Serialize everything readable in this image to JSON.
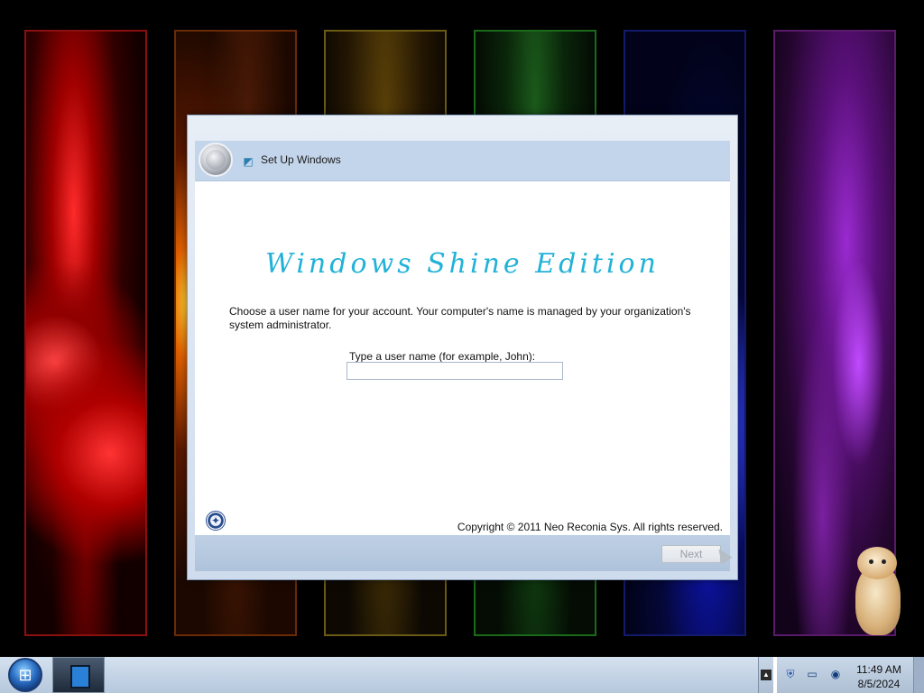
{
  "colors": {
    "brand_text": "#22b2d8",
    "dialog_header": "#c3d5ea",
    "taskbar": "#c6d6e8",
    "panels": [
      "#8a1010",
      "#6a2a08",
      "#6a5a14",
      "#1a6a1a",
      "#141a6a",
      "#5a1a6a"
    ]
  },
  "dialog": {
    "title": "Set Up Windows",
    "brand": "Windows Shine Edition",
    "instructions": "Choose a user name for your account.  Your computer's name is managed by your organization's system administrator.",
    "username_label": "Type a user name (for example, John):",
    "username_value": "",
    "copyright": "Copyright © 2011 Neo Reconia Sys.  All rights reserved.",
    "next_label": "Next",
    "next_enabled": false,
    "icons": {
      "back": "back-arrow-icon",
      "setup": "setup-icon",
      "accessibility": "ease-of-access-icon"
    }
  },
  "taskbar": {
    "start": "windows-logo-icon",
    "items": [
      "window-item"
    ],
    "tray_icons": [
      "show-hidden-icons-icon",
      "security-shield-icon",
      "network-icon",
      "volume-icon"
    ],
    "time": "11:49 AM",
    "date": "8/5/2024"
  }
}
